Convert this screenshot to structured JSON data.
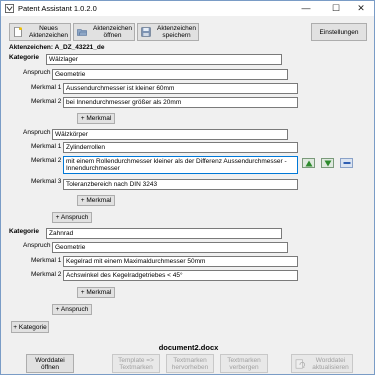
{
  "window": {
    "title": "Patent Assistant 1.0.2.0",
    "min_glyph": "—",
    "max_glyph": "☐",
    "close_glyph": "✕"
  },
  "toolbar": {
    "new_label": "Neues Aktenzeichen",
    "open_label": "Aktenzeichen öffnen",
    "save_label": "Aktenzeichen speichern",
    "settings_label": "Einstellungen"
  },
  "file_number": "Aktenzeichen: A_DZ_43221_de",
  "labels": {
    "kategorie": "Kategorie",
    "anspruch": "Anspruch",
    "merkmal_1": "Merkmal 1",
    "merkmal_2": "Merkmal 2",
    "merkmal_3": "Merkmal 3",
    "add_merkmal": "+ Merkmal",
    "add_anspruch": "+ Anspruch",
    "add_kategorie": "+ Kategorie"
  },
  "categories": [
    {
      "value": "Wälzlager",
      "claims": [
        {
          "value": "Geometrie",
          "features": [
            "Aussendurchmesser ist kleiner 60mm",
            "bei Innendurchmesser größer als 20mm"
          ]
        },
        {
          "value": "Wälzkörper",
          "features": [
            "Zylinderrollen",
            "mit einem Rollendurchmesser kleiner als der Differenz Aussendurchmesser - Innendurchmesser",
            "Toleranzbereich nach DIN 3243"
          ]
        }
      ]
    },
    {
      "value": "Zahnrad",
      "claims": [
        {
          "value": "Geometrie",
          "features": [
            "Kegelrad mit einem Maximaldurchmesser 50mm",
            "Achswinkel des Kegelradgetriebes < 45°"
          ]
        }
      ]
    }
  ],
  "document_name": "document2.docx",
  "bottom_buttons": {
    "open_word": "Worddatei öffnen",
    "template_to_textmarks": "Template => Textmarken",
    "hide_textmarks": "Textmarken hervorheben",
    "show_textmarks": "Textmarken verbergen",
    "update_word": "Worddatei aktualisieren"
  },
  "colors": {
    "accent_blue": "#0078d7",
    "arrow_green": "#2e8b2e",
    "minus_blue": "#2f5fb3"
  }
}
